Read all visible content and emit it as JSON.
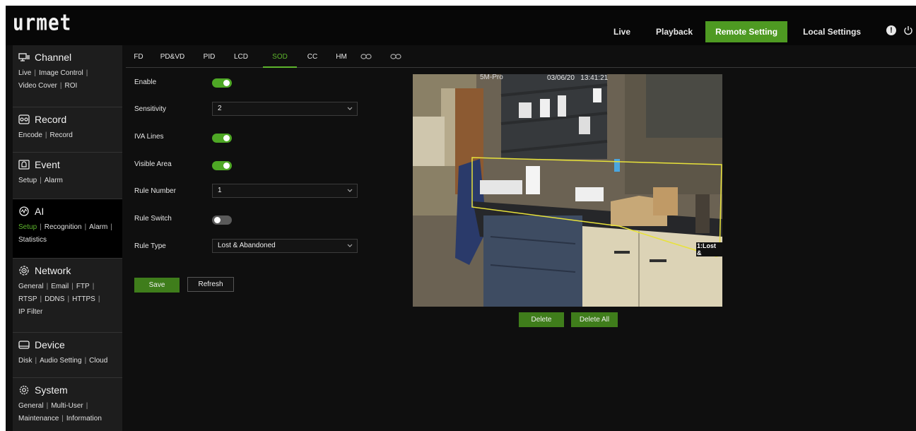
{
  "header": {
    "logo": "urmet",
    "nav": [
      "Live",
      "Playback",
      "Remote Setting",
      "Local Settings"
    ],
    "active_nav": "Remote Setting",
    "accent_color": "#4e9a22"
  },
  "sidebar": {
    "sections": [
      {
        "title": "Channel",
        "icon": "channel-icon",
        "links": [
          "Live",
          "Image Control",
          "Video Cover",
          "ROI"
        ]
      },
      {
        "title": "Record",
        "icon": "record-icon",
        "links": [
          "Encode",
          "Record"
        ]
      },
      {
        "title": "Event",
        "icon": "event-icon",
        "links": [
          "Setup",
          "Alarm"
        ]
      },
      {
        "title": "AI",
        "icon": "ai-icon",
        "links": [
          "Setup",
          "Recognition",
          "Alarm",
          "Statistics"
        ]
      },
      {
        "title": "Network",
        "icon": "network-icon",
        "links": [
          "General",
          "Email",
          "FTP",
          "RTSP",
          "DDNS",
          "HTTPS",
          "IP Filter"
        ]
      },
      {
        "title": "Device",
        "icon": "device-icon",
        "links": [
          "Disk",
          "Audio Setting",
          "Cloud"
        ]
      },
      {
        "title": "System",
        "icon": "system-icon",
        "links": [
          "General",
          "Multi-User",
          "Maintenance",
          "Information"
        ]
      }
    ],
    "active_section": "AI",
    "active_link": "Setup"
  },
  "tabs": {
    "items": [
      "FD",
      "PD&VD",
      "PID",
      "LCD",
      "SOD",
      "CC",
      "HM"
    ],
    "icon_tabs": [
      "link-icon",
      "link-icon"
    ],
    "active": "SOD"
  },
  "form": {
    "enable_label": "Enable",
    "enable_on": true,
    "sensitivity_label": "Sensitivity",
    "sensitivity_value": "2",
    "iva_lines_label": "IVA Lines",
    "iva_lines_on": true,
    "visible_area_label": "Visible Area",
    "visible_area_on": true,
    "rule_number_label": "Rule Number",
    "rule_number_value": "1",
    "rule_switch_label": "Rule Switch",
    "rule_switch_on": false,
    "rule_type_label": "Rule Type",
    "rule_type_value": "Lost & Abandoned",
    "save_label": "Save",
    "refresh_label": "Refresh"
  },
  "preview": {
    "channel_name": "5M-Pro",
    "timestamp": "03/06/20   13:41:21",
    "rule_tag": "1:Lost &",
    "rule_line_color": "#e8e23a",
    "delete_label": "Delete",
    "delete_all_label": "Delete All"
  }
}
